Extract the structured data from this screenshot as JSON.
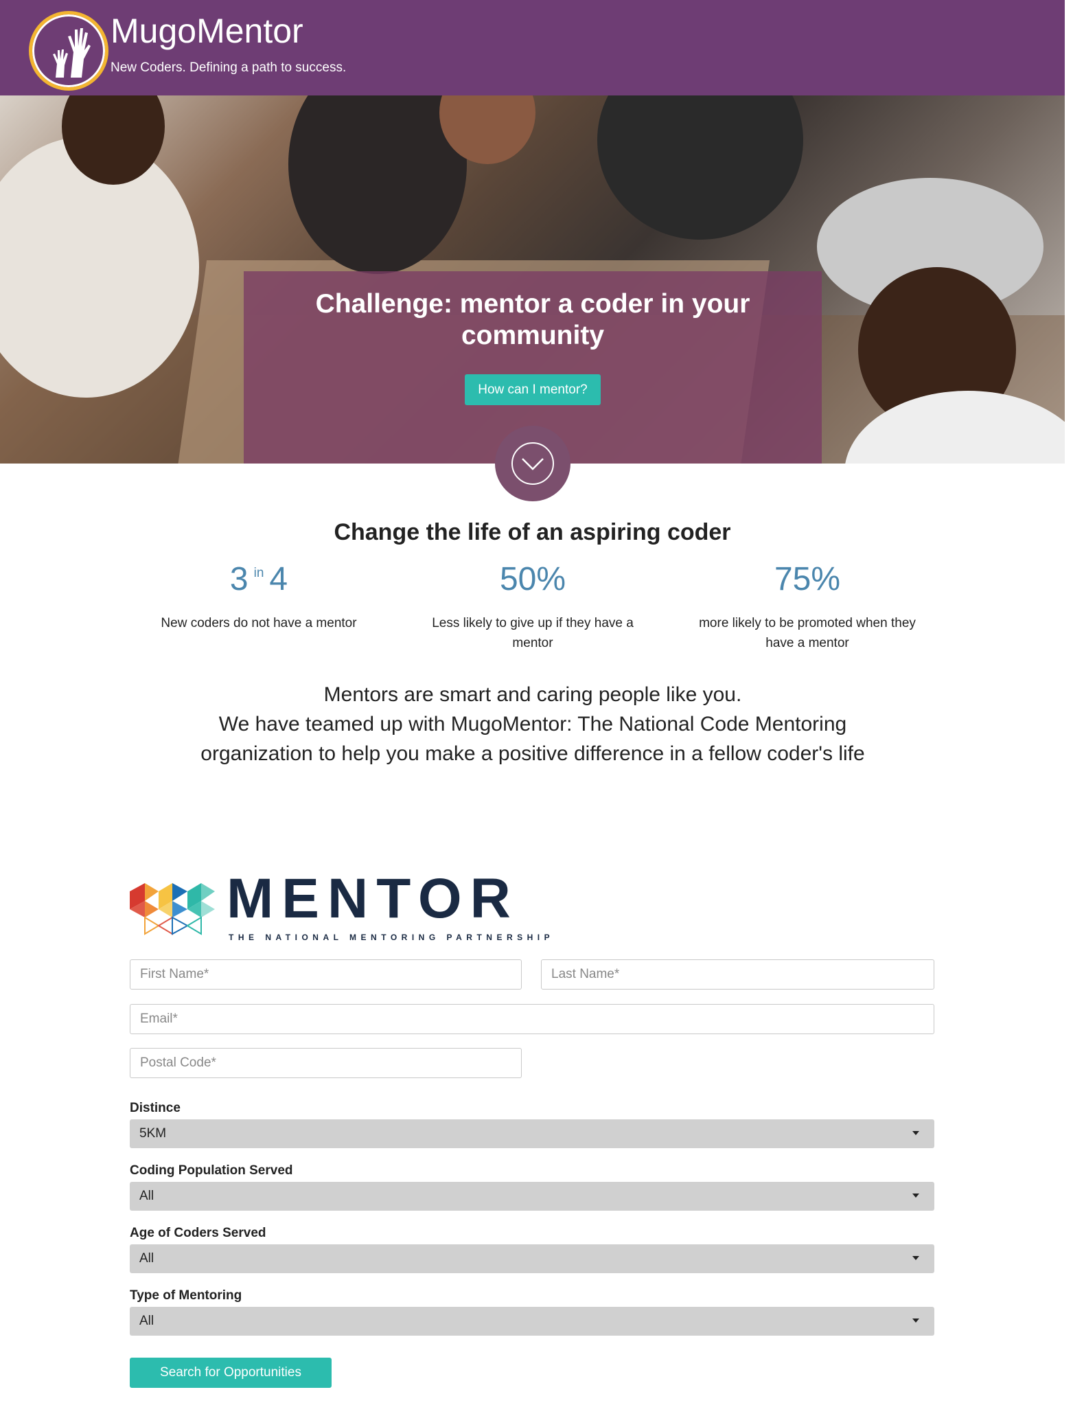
{
  "header": {
    "brand": "MugoMentor",
    "tagline": "New Coders. Defining a path to success."
  },
  "hero": {
    "title": "Challenge: mentor a coder in your community",
    "cta_label": "How can I mentor?"
  },
  "stats_section": {
    "headline": "Change the life of an aspiring coder",
    "stats": [
      {
        "value_a": "3",
        "value_mid": "in",
        "value_b": "4",
        "desc": "New coders do not have a mentor"
      },
      {
        "value": "50%",
        "desc": "Less likely to give up if they have a mentor"
      },
      {
        "value": "75%",
        "desc": "more likely to be promoted when they have a mentor"
      }
    ]
  },
  "mission": {
    "line1": "Mentors are smart and caring people like you.",
    "line2": "We have teamed up with MugoMentor: The National Code Mentoring organization to help you make a positive difference in a fellow coder's life"
  },
  "partner_logo": {
    "word": "MENTOR",
    "subtitle": "THE NATIONAL MENTORING PARTNERSHIP"
  },
  "form": {
    "first_name_placeholder": "First Name*",
    "last_name_placeholder": "Last Name*",
    "email_placeholder": "Email*",
    "postal_placeholder": "Postal Code*",
    "distance_label": "Distince",
    "distance_value": "5KM",
    "population_label": "Coding Population Served",
    "population_value": "All",
    "age_label": "Age of Coders Served",
    "age_value": "All",
    "type_label": "Type of Mentoring",
    "type_value": "All",
    "submit_label": "Search for Opportunities"
  },
  "colors": {
    "header_bg": "#6e3d74",
    "logo_ring": "#f3b531",
    "accent_teal": "#2cbcae",
    "stat_blue": "#4b86ad",
    "mentor_navy": "#1a2a43"
  }
}
